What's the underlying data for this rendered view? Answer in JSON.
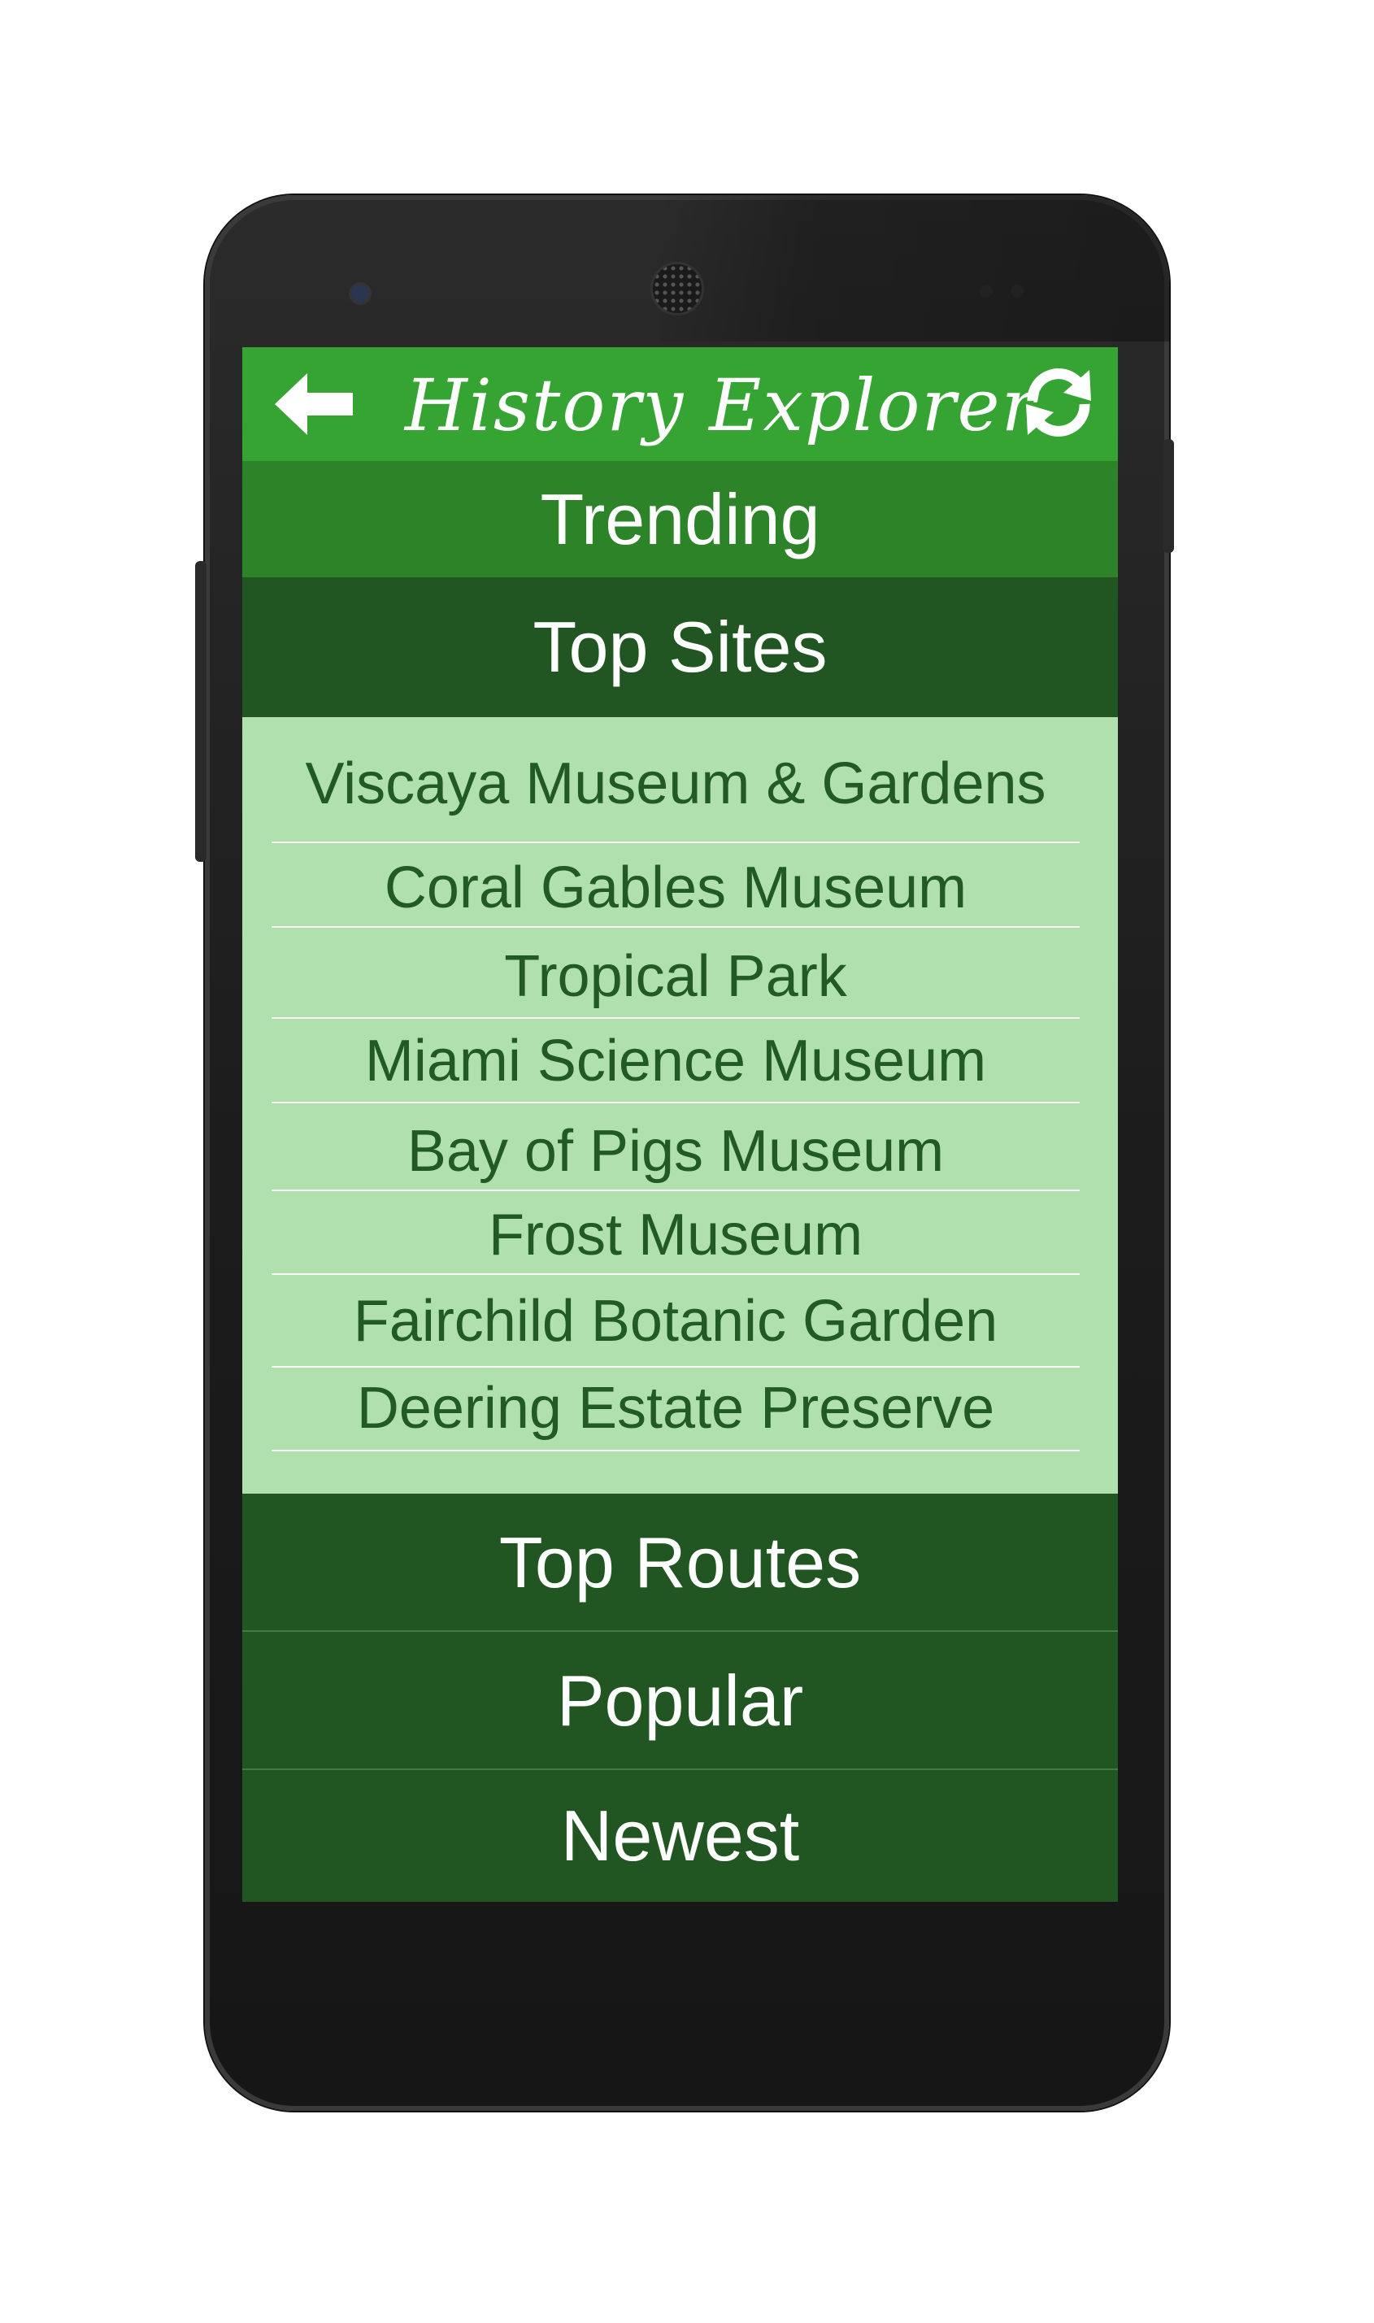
{
  "app": {
    "title": "History Explorer"
  },
  "header": {
    "back_icon": "arrow-left-icon",
    "refresh_icon": "refresh-icon"
  },
  "tabs": {
    "trending": "Trending",
    "top_sites": "Top Sites",
    "top_routes": "Top Routes",
    "popular": "Popular",
    "newest": "Newest"
  },
  "top_sites": [
    "Viscaya Museum & Gardens",
    "Coral Gables Museum",
    "Tropical Park",
    "Miami Science Museum",
    "Bay of Pigs Museum",
    "Frost Museum",
    "Fairchild Botanic Garden",
    "Deering Estate Preserve"
  ],
  "colors": {
    "header": "#35a432",
    "trending": "#2d8328",
    "dark_tab": "#215623",
    "list_bg": "#b0e0ad",
    "list_text": "#215a24"
  }
}
